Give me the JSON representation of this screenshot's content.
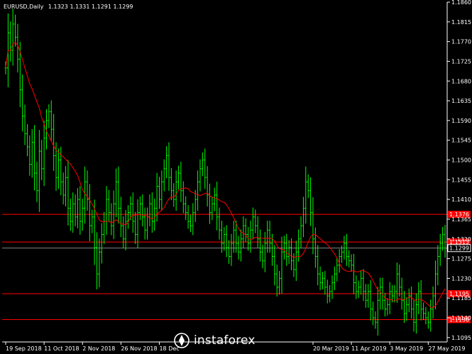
{
  "header": {
    "symbol": "EURUSD,Daily",
    "ohlc": "1.1323 1.1331 1.1291 1.1299"
  },
  "watermark": {
    "text": "instaforex",
    "logo": "instaforex-logo-icon"
  },
  "colors": {
    "background": "#000000",
    "bull": "#00ff00",
    "ma": "#ff0000",
    "level": "#ff0000",
    "current": "#ffffff",
    "axis": "#ffffff"
  },
  "chart_data": {
    "type": "line",
    "title": "",
    "xlabel": "",
    "ylabel": "",
    "ylim": [
      1.1085,
      1.186
    ],
    "y_ticks": [
      "1.1860",
      "1.1815",
      "1.1770",
      "1.1725",
      "1.1680",
      "1.1635",
      "1.1590",
      "1.1545",
      "1.1500",
      "1.1455",
      "1.1410",
      "1.1365",
      "1.1320",
      "1.1275",
      "1.1230",
      "1.1185",
      "1.1140",
      "1.1095"
    ],
    "x_ticks": [
      {
        "i": 0,
        "label": "19 Sep 2018"
      },
      {
        "i": 16,
        "label": "11 Oct 2018"
      },
      {
        "i": 32,
        "label": "2 Nov 2018"
      },
      {
        "i": 48,
        "label": "26 Nov 2018"
      },
      {
        "i": 64,
        "label": "18 Dec"
      },
      {
        "i": 128,
        "label": "20 Mar 2019"
      },
      {
        "i": 144,
        "label": "11 Apr 2019"
      },
      {
        "i": 160,
        "label": "3 May 2019"
      },
      {
        "i": 176,
        "label": "27 May 2019"
      }
    ],
    "price_levels": [
      {
        "value": 1.1376,
        "label": "1.1376"
      },
      {
        "value": 1.1313,
        "label": "1.1313"
      },
      {
        "value": 1.1195,
        "label": "1.1195"
      },
      {
        "value": 1.1136,
        "label": "1.1136"
      }
    ],
    "current_price": {
      "value": 1.1299,
      "label": "1.1299"
    },
    "series": [
      {
        "values": [
          1.171,
          1.179,
          1.175,
          1.181,
          1.178,
          1.173,
          1.166,
          1.16,
          1.156,
          1.153,
          1.149,
          1.154,
          1.147,
          1.143,
          1.152,
          1.148,
          1.155,
          1.159,
          1.161,
          1.157,
          1.151,
          1.146,
          1.15,
          1.145,
          1.142,
          1.146,
          1.139,
          1.136,
          1.14,
          1.137,
          1.141,
          1.136,
          1.139,
          1.145,
          1.141,
          1.135,
          1.137,
          1.13,
          1.124,
          1.129,
          1.133,
          1.136,
          1.141,
          1.138,
          1.135,
          1.14,
          1.145,
          1.139,
          1.135,
          1.132,
          1.136,
          1.138,
          1.14,
          1.136,
          1.133,
          1.138,
          1.14,
          1.137,
          1.134,
          1.137,
          1.14,
          1.136,
          1.139,
          1.144,
          1.141,
          1.145,
          1.148,
          1.151,
          1.146,
          1.143,
          1.141,
          1.145,
          1.147,
          1.143,
          1.14,
          1.138,
          1.136,
          1.135,
          1.138,
          1.141,
          1.145,
          1.148,
          1.15,
          1.146,
          1.142,
          1.138,
          1.14,
          1.142,
          1.137,
          1.134,
          1.131,
          1.133,
          1.13,
          1.128,
          1.131,
          1.134,
          1.131,
          1.129,
          1.132,
          1.135,
          1.133,
          1.131,
          1.134,
          1.137,
          1.135,
          1.132,
          1.129,
          1.127,
          1.131,
          1.134,
          1.131,
          1.128,
          1.124,
          1.121,
          1.123,
          1.129,
          1.131,
          1.128,
          1.13,
          1.127,
          1.125,
          1.129,
          1.132,
          1.135,
          1.139,
          1.145,
          1.143,
          1.138,
          1.132,
          1.128,
          1.124,
          1.122,
          1.123,
          1.121,
          1.119,
          1.12,
          1.122,
          1.124,
          1.126,
          1.128,
          1.129,
          1.131,
          1.128,
          1.127,
          1.126,
          1.122,
          1.12,
          1.121,
          1.123,
          1.12,
          1.118,
          1.12,
          1.116,
          1.114,
          1.113,
          1.118,
          1.121,
          1.118,
          1.116,
          1.117,
          1.12,
          1.119,
          1.12,
          1.124,
          1.121,
          1.118,
          1.115,
          1.117,
          1.119,
          1.116,
          1.113,
          1.117,
          1.12,
          1.116,
          1.115,
          1.114,
          1.113,
          1.116,
          1.119,
          1.124,
          1.128,
          1.131,
          1.133,
          1.1299
        ]
      }
    ]
  }
}
